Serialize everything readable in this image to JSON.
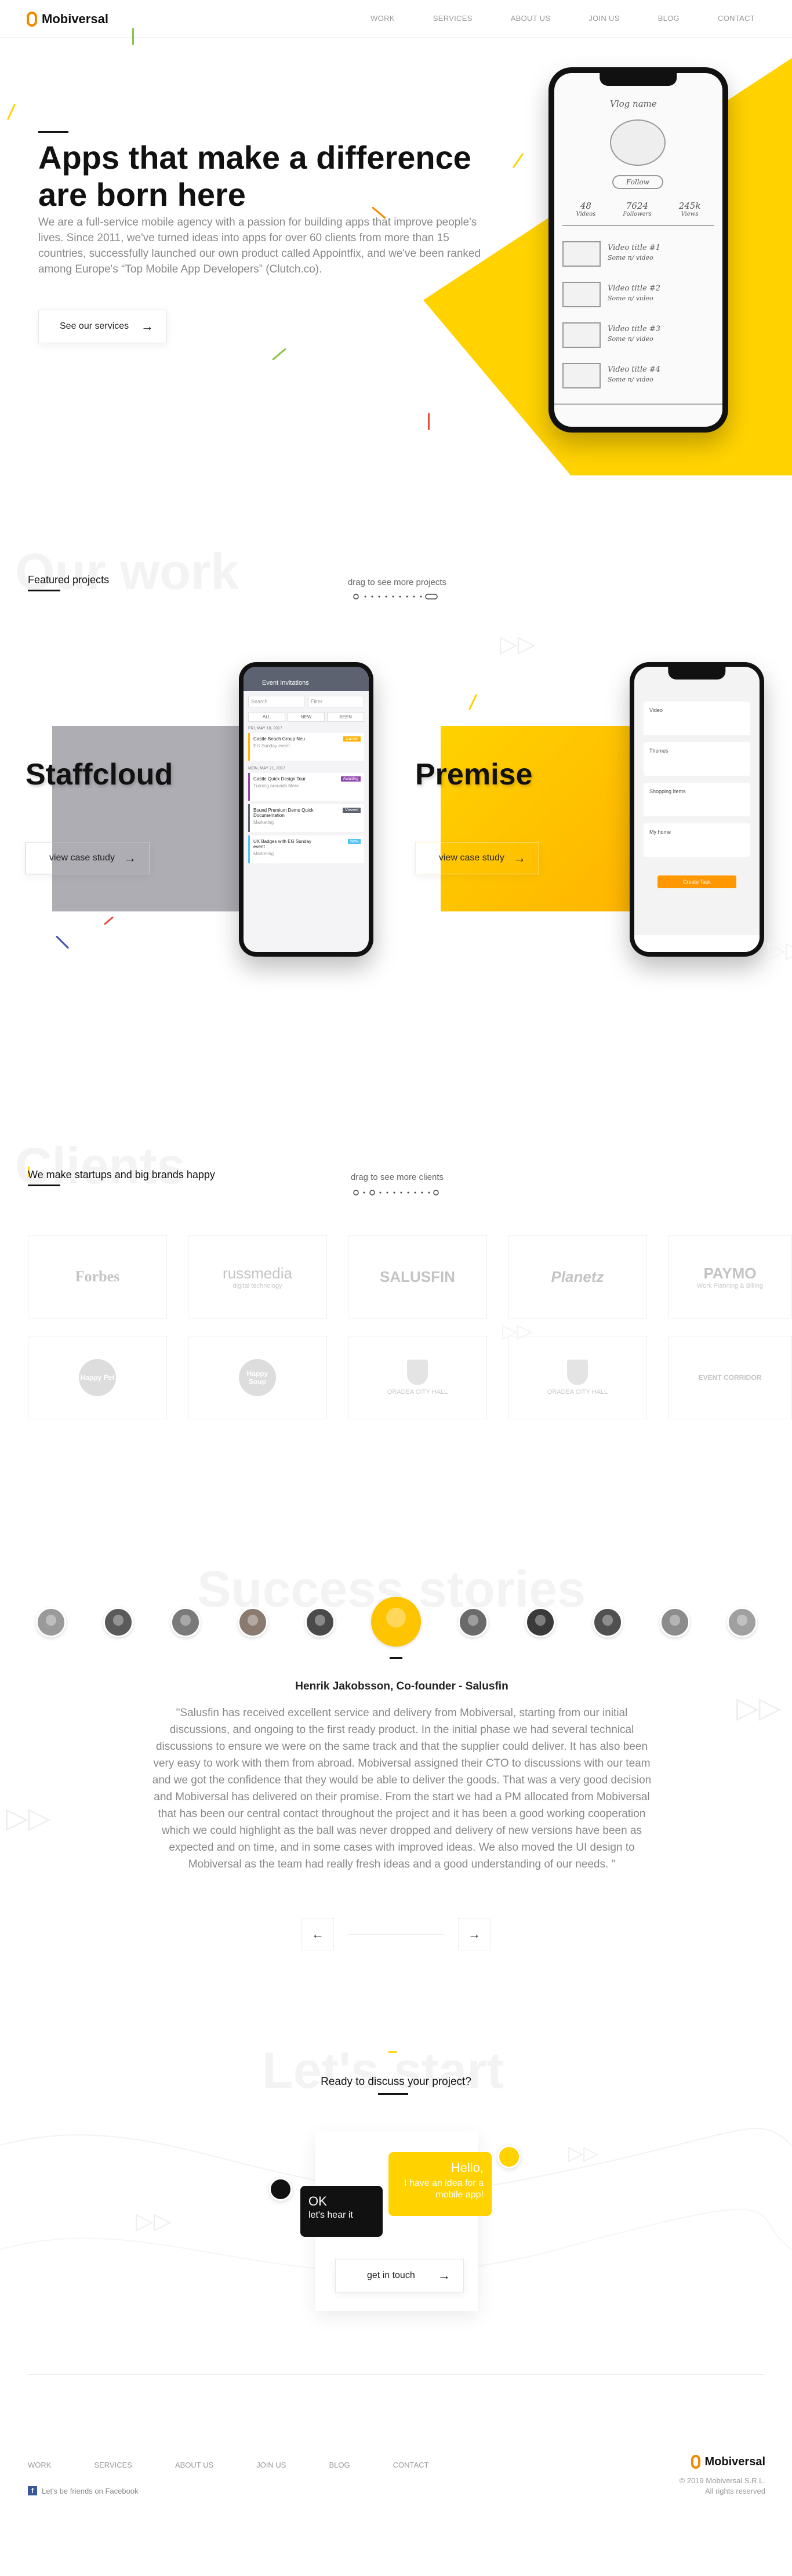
{
  "header": {
    "logo_text": "Mobiversal",
    "nav": [
      "WORK",
      "SERVICES",
      "ABOUT US",
      "JOIN US",
      "BLOG",
      "CONTACT"
    ]
  },
  "hero": {
    "title": "Apps that make a difference are born here",
    "description": "We are a full-service mobile agency with a passion for building apps that improve people's lives. Since 2011, we've turned ideas into apps for over 60 clients from more than 15 countries, successfully launched our own product called Appointfix, and we've been ranked among Europe's “Top Mobile App Developers” (Clutch.co).",
    "cta": "See our services",
    "phone": {
      "name": "Vlog name",
      "follow": "Follow",
      "stats": [
        {
          "value": "48",
          "label": "Videos"
        },
        {
          "value": "7624",
          "label": "Followers"
        },
        {
          "value": "245k",
          "label": "Views"
        }
      ],
      "videos": [
        {
          "title": "Video title #1",
          "sub": "Some n/ video"
        },
        {
          "title": "Video title #2",
          "sub": "Some n/ video"
        },
        {
          "title": "Video title #3",
          "sub": "Some n/ video"
        },
        {
          "title": "Video title #4",
          "sub": "Some n/ video"
        }
      ]
    }
  },
  "work": {
    "ghost": "Our work",
    "heading": "Featured projects",
    "drag_hint": "drag to see more projects",
    "projects": [
      {
        "title": "Staffcloud",
        "cta": "view case study",
        "screen_title": "Event Invitations",
        "search": "Search",
        "filter": "Filter",
        "tabs": [
          "ALL",
          "NEW",
          "SEEN"
        ],
        "groups": [
          {
            "date": "FRI, MAY 18, 2017",
            "items": [
              {
                "title": "Castle Beach Group Neu",
                "sub": "EG Sunday event",
                "tag": "Cancel"
              }
            ]
          },
          {
            "date": "MON, MAY 21, 2017",
            "items": [
              {
                "title": "Castle Quick Design Tour",
                "sub": "Turning arounds Mere",
                "tag": "Awaiting"
              },
              {
                "title": "Bound Premium Demo Quick Documentation",
                "sub": "Marketing",
                "tag": "Viewed"
              },
              {
                "title": "UX Badges with EG Sunday event",
                "sub": "Marketing",
                "tag": "New"
              }
            ]
          }
        ]
      },
      {
        "title": "Premise",
        "cta": "view case study",
        "cards": [
          "Video",
          "Themes",
          "Shopping Items",
          "My home"
        ],
        "button": "Create Task"
      }
    ]
  },
  "clients": {
    "ghost": "Clients",
    "heading": "We make startups and big brands happy",
    "drag_hint": "drag to see more clients",
    "logos": [
      {
        "name": "Forbes",
        "sub": ""
      },
      {
        "name": "russmedia",
        "sub": "digital technology"
      },
      {
        "name": "SALUSFIN",
        "sub": ""
      },
      {
        "name": "Planetz",
        "sub": ""
      },
      {
        "name": "PAYMO",
        "sub": "Work Planning & Billing"
      },
      {
        "name": "Happy Pet",
        "sub": ""
      },
      {
        "name": "Happy Soup",
        "sub": ""
      },
      {
        "name": "",
        "sub": "ORADEA CITY HALL"
      },
      {
        "name": "",
        "sub": "ORADEA CITY HALL"
      },
      {
        "name": "EVENT CORRIDOR",
        "sub": ""
      }
    ]
  },
  "stories": {
    "ghost": "Success stories",
    "name": "Henrik Jakobsson, Co-founder - Salusfin",
    "quote": "\"Salusfin has received excellent service and delivery from Mobiversal, starting from our initial discussions, and ongoing to the first ready product. In the initial phase we had several technical discussions to ensure we were on the same track and that the supplier could deliver. It has also been very easy to work with them from abroad. Mobiversal assigned their CTO to discussions with our team and we got the confidence that they would be able to deliver the goods. That was a very good decision and Mobiversal has delivered on their promise. From the start we had a PM allocated from Mobiversal that has been our central contact throughout the project and it has been a good working cooperation which we could highlight as the ball was never dropped and delivery of new versions have been as expected and on time, and in some cases with improved ideas. We also moved the UI design to Mobiversal as the team had really fresh ideas and a good understanding of our needs. \""
  },
  "contact": {
    "ghost": "Let's start",
    "heading": "Ready to discuss your project?",
    "bubble_hello": "Hello,",
    "bubble_idea": "I have an idea for a mobile app!",
    "bubble_ok": "OK",
    "bubble_hear": "let's hear it",
    "cta": "get in touch"
  },
  "footer": {
    "nav": [
      "WORK",
      "SERVICES",
      "ABOUT US",
      "JOIN US",
      "BLOG",
      "CONTACT"
    ],
    "facebook": "Let's be friends on Facebook",
    "logo_text": "Mobiversal",
    "copyright": "© 2019 Mobiversal S.R.L.",
    "rights": "All rights reserved"
  },
  "colors": {
    "accent": "#ffd200",
    "dark": "#111111",
    "muted": "#888888"
  }
}
